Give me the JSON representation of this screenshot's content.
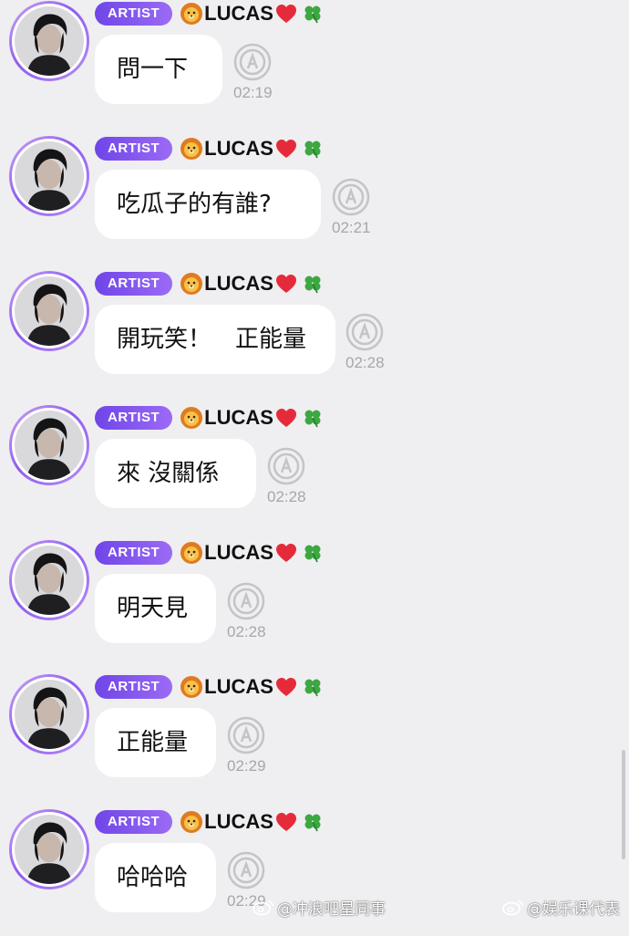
{
  "sender": {
    "badge": "ARTIST",
    "nickname": "LUCAS",
    "nickname_emojis": [
      "lion-face-icon",
      "red-heart-icon",
      "four-leaf-clover-icon"
    ]
  },
  "messages": [
    {
      "text": "問一下",
      "time": "02:19"
    },
    {
      "text": "吃瓜子的有誰?",
      "time": "02:21"
    },
    {
      "text": "開玩笑！　正能量",
      "time": "02:28"
    },
    {
      "text": "來 沒關係",
      "time": "02:28"
    },
    {
      "text": "明天見",
      "time": "02:28"
    },
    {
      "text": "正能量",
      "time": "02:29"
    },
    {
      "text": "哈哈哈",
      "time": "02:29"
    }
  ],
  "watermarks": [
    {
      "text": "@冲浪吧星同事"
    },
    {
      "text": "@娱乐课代表"
    }
  ],
  "colors": {
    "background": "#efeff1",
    "bubble": "#ffffff",
    "badge_start": "#6f45e8",
    "badge_end": "#9b6bf5",
    "timestamp": "#a7a7ab"
  }
}
